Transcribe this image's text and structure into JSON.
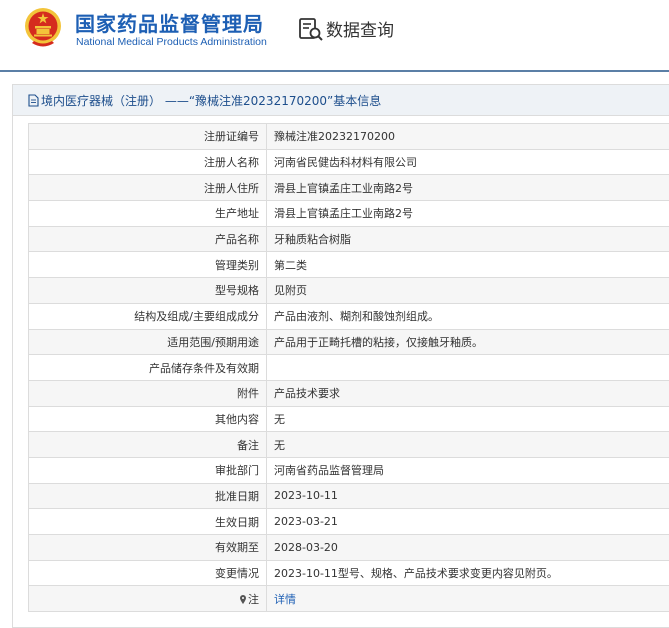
{
  "header": {
    "org_cn": "国家药品监督管理局",
    "org_en": "National Medical Products Administration",
    "query_label": "数据查询"
  },
  "panel": {
    "title": "境内医疗器械（注册） ——“豫械注准20232170200”基本信息"
  },
  "rows": [
    {
      "label": "注册证编号",
      "value": "豫械注准20232170200"
    },
    {
      "label": "注册人名称",
      "value": "河南省民健齿科材料有限公司"
    },
    {
      "label": "注册人住所",
      "value": "滑县上官镇孟庄工业南路2号"
    },
    {
      "label": "生产地址",
      "value": "滑县上官镇孟庄工业南路2号"
    },
    {
      "label": "产品名称",
      "value": "牙釉质粘合树脂"
    },
    {
      "label": "管理类别",
      "value": "第二类"
    },
    {
      "label": "型号规格",
      "value": "见附页"
    },
    {
      "label": "结构及组成/主要组成成分",
      "value": "产品由液剂、糊剂和酸蚀剂组成。"
    },
    {
      "label": "适用范围/预期用途",
      "value": "产品用于正畸托槽的粘接，仅接触牙釉质。"
    },
    {
      "label": "产品储存条件及有效期",
      "value": ""
    },
    {
      "label": "附件",
      "value": "产品技术要求"
    },
    {
      "label": "其他内容",
      "value": "无"
    },
    {
      "label": "备注",
      "value": "无"
    },
    {
      "label": "审批部门",
      "value": "河南省药品监督管理局"
    },
    {
      "label": "批准日期",
      "value": "2023-10-11"
    },
    {
      "label": "生效日期",
      "value": "2023-03-21"
    },
    {
      "label": "有效期至",
      "value": "2028-03-20"
    },
    {
      "label": "变更情况",
      "value": "2023-10-11型号、规格、产品技术要求变更内容见附页。"
    },
    {
      "label": "注",
      "value": "详情"
    }
  ],
  "colors": {
    "brand_blue": "#1d5fb4",
    "title_bar": "#eef2f6",
    "emblem_red": "#d52b1e",
    "emblem_gold": "#f3c43a"
  }
}
